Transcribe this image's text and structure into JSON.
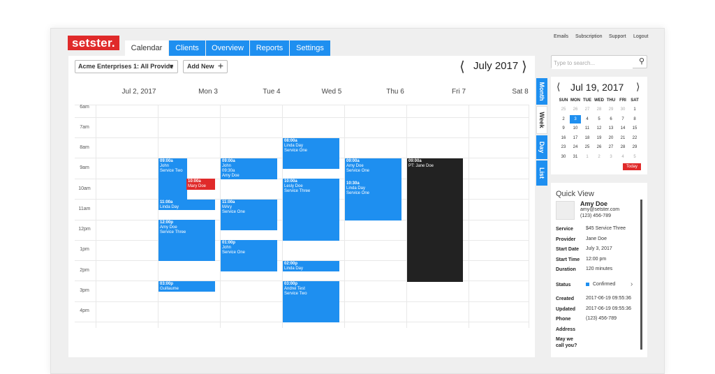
{
  "brand": {
    "logo_text": "setster."
  },
  "nav": {
    "tabs": [
      {
        "label": "Calendar"
      },
      {
        "label": "Clients"
      },
      {
        "label": "Overview"
      },
      {
        "label": "Reports"
      },
      {
        "label": "Settings"
      }
    ],
    "top_links": [
      {
        "label": "Emails"
      },
      {
        "label": "Subscription"
      },
      {
        "label": "Support"
      },
      {
        "label": "Logout"
      }
    ]
  },
  "toolbar": {
    "provider_select": "Acme Enterprises 1: All Provide",
    "add_new_label": "Add New",
    "add_new_icon": "plus-icon",
    "month_title": "July 2017"
  },
  "week": {
    "days": [
      "Jul 2, 2017",
      "Mon 3",
      "Tue 4",
      "Wed 5",
      "Thu 6",
      "Fri 7",
      "Sat 8"
    ],
    "hours": [
      "6am",
      "7am",
      "8am",
      "9am",
      "10am",
      "11am",
      "12pm",
      "1pm",
      "2pm",
      "3pm",
      "4pm"
    ]
  },
  "appointments": [
    {
      "time": "09:00a",
      "lines": [
        "John",
        "Service Two"
      ],
      "color": "#1e8ff0"
    },
    {
      "time": "10:00a",
      "lines": [
        "Mary Doe"
      ],
      "color": "#e02a2a"
    },
    {
      "time": "11:00a",
      "lines": [
        "Linda Day"
      ],
      "color": "#1e8ff0"
    },
    {
      "time": "12:00p",
      "lines": [
        "Amy Doe",
        "Service Three"
      ],
      "color": "#1e8ff0"
    },
    {
      "time": "03:00p",
      "lines": [
        "Guillaume"
      ],
      "color": "#1e8ff0"
    },
    {
      "time": "09:00a",
      "lines": [
        "John",
        "09:30a",
        "Amy Doe"
      ],
      "color": "#1e8ff0"
    },
    {
      "time": "11:00a",
      "lines": [
        "MAry",
        "Service One"
      ],
      "color": "#1e8ff0"
    },
    {
      "time": "01:00p",
      "lines": [
        "John",
        "Service One"
      ],
      "color": "#1e8ff0"
    },
    {
      "time": "08:00a",
      "lines": [
        "Linda Day",
        "Service One"
      ],
      "color": "#1e8ff0"
    },
    {
      "time": "10:00a",
      "lines": [
        "Lesly Doe",
        "Service Three"
      ],
      "color": "#1e8ff0"
    },
    {
      "time": "02:00p",
      "lines": [
        "Linda Day"
      ],
      "color": "#1e8ff0"
    },
    {
      "time": "03:00p",
      "lines": [
        "Andrei Test",
        "Service Two"
      ],
      "color": "#1e8ff0"
    },
    {
      "time": "09:00a",
      "lines": [
        "Amy Doe",
        "Service One"
      ],
      "color": "#1e8ff0"
    },
    {
      "time": "10:30a",
      "lines": [
        "Linda Day",
        "Service One"
      ],
      "color": "#1e8ff0"
    },
    {
      "time": "09:00a",
      "lines": [
        "PT: Jane Doe"
      ],
      "color": "#222222"
    }
  ],
  "view_tabs": [
    {
      "label": "Month"
    },
    {
      "label": "Week"
    },
    {
      "label": "Day"
    },
    {
      "label": "List"
    }
  ],
  "search": {
    "placeholder": "Type to search...",
    "icon": "search-icon"
  },
  "mini_calendar": {
    "title": "Jul 19, 2017",
    "weekdays": [
      "SUN",
      "MON",
      "TUE",
      "WED",
      "THU",
      "FRI",
      "SAT"
    ],
    "weeks": [
      [
        "25",
        "26",
        "27",
        "28",
        "29",
        "30",
        "1"
      ],
      [
        "2",
        "3",
        "4",
        "5",
        "6",
        "7",
        "8"
      ],
      [
        "9",
        "10",
        "11",
        "12",
        "13",
        "14",
        "15"
      ],
      [
        "16",
        "17",
        "18",
        "19",
        "20",
        "21",
        "22"
      ],
      [
        "23",
        "24",
        "25",
        "26",
        "27",
        "28",
        "29"
      ],
      [
        "30",
        "31",
        "1",
        "2",
        "3",
        "4",
        "5"
      ]
    ],
    "today_label": "Today"
  },
  "quick_view": {
    "title": "Quick View",
    "name": "Amy Doe",
    "email": "amy@setster.com",
    "phone": "(123) 456-789",
    "fields": [
      {
        "label": "Service",
        "value": "$45 Service Three"
      },
      {
        "label": "Provider",
        "value": "Jane Doe"
      },
      {
        "label": "Start Date",
        "value": "July 3, 2017"
      },
      {
        "label": "Start Time",
        "value": "12:00 pm"
      },
      {
        "label": "Duration",
        "value": "120 minutes"
      },
      {
        "label": "Status",
        "value": "Confirmed"
      },
      {
        "label": "Created",
        "value": "2017-06-19 09:55:36"
      },
      {
        "label": "Updated",
        "value": "2017-06-19 09:55:36"
      },
      {
        "label": "Phone",
        "value": "(123) 456-789"
      },
      {
        "label": "Address",
        "value": ""
      },
      {
        "label": "May we call you?",
        "value": ""
      }
    ]
  }
}
